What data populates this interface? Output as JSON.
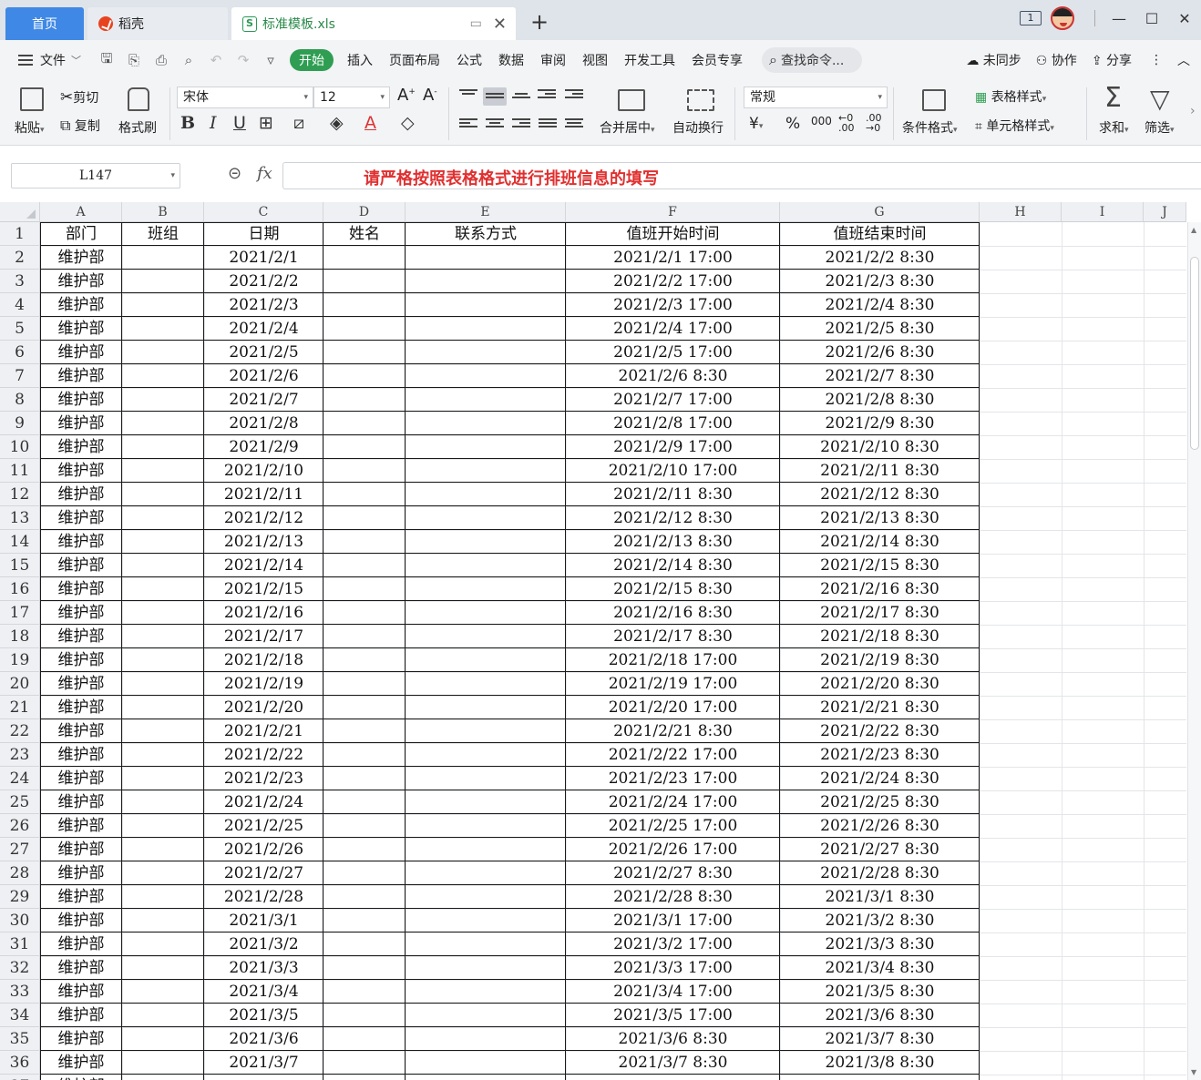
{
  "titlebar": {
    "tabs": [
      {
        "label": "首页"
      },
      {
        "label": "稻壳"
      },
      {
        "label": "标准模板.xls"
      }
    ],
    "new_tab_label": "+",
    "page_indicator": "1"
  },
  "menubar": {
    "file_label": "文件",
    "items": [
      "开始",
      "插入",
      "页面布局",
      "公式",
      "数据",
      "审阅",
      "视图",
      "开发工具",
      "会员专享"
    ],
    "search_placeholder": "查找命令...",
    "right_items": [
      "未同步",
      "协作",
      "分享"
    ]
  },
  "ribbon": {
    "paste_label": "粘贴",
    "cut_label": "剪切",
    "copy_label": "复制",
    "format_painter_label": "格式刷",
    "font_name": "宋体",
    "font_size": "12",
    "merge_label": "合并居中",
    "wrap_label": "自动换行",
    "number_format": "常规",
    "cond_format_label": "条件格式",
    "table_style_label": "表格样式",
    "cell_style_label": "单元格样式",
    "sum_label": "求和",
    "filter_label": "筛选"
  },
  "formula_bar": {
    "cell_ref": "L147",
    "fx_label": "fx",
    "content": "请严格按照表格格式进行排班信息的填写"
  },
  "sheet": {
    "columns": [
      "A",
      "B",
      "C",
      "D",
      "E",
      "F",
      "G",
      "H",
      "I",
      "J"
    ],
    "header_row": [
      "部门",
      "班组",
      "日期",
      "姓名",
      "联系方式",
      "值班开始时间",
      "值班结束时间"
    ],
    "rows": [
      {
        "n": "2",
        "dept": "维护部",
        "date": "2021/2/1",
        "start": "2021/2/1 17:00",
        "end": "2021/2/2 8:30"
      },
      {
        "n": "3",
        "dept": "维护部",
        "date": "2021/2/2",
        "start": "2021/2/2 17:00",
        "end": "2021/2/3 8:30"
      },
      {
        "n": "4",
        "dept": "维护部",
        "date": "2021/2/3",
        "start": "2021/2/3 17:00",
        "end": "2021/2/4 8:30"
      },
      {
        "n": "5",
        "dept": "维护部",
        "date": "2021/2/4",
        "start": "2021/2/4 17:00",
        "end": "2021/2/5 8:30"
      },
      {
        "n": "6",
        "dept": "维护部",
        "date": "2021/2/5",
        "start": "2021/2/5 17:00",
        "end": "2021/2/6 8:30"
      },
      {
        "n": "7",
        "dept": "维护部",
        "date": "2021/2/6",
        "start": "2021/2/6 8:30",
        "end": "2021/2/7 8:30"
      },
      {
        "n": "8",
        "dept": "维护部",
        "date": "2021/2/7",
        "start": "2021/2/7 17:00",
        "end": "2021/2/8 8:30"
      },
      {
        "n": "9",
        "dept": "维护部",
        "date": "2021/2/8",
        "start": "2021/2/8 17:00",
        "end": "2021/2/9 8:30"
      },
      {
        "n": "10",
        "dept": "维护部",
        "date": "2021/2/9",
        "start": "2021/2/9 17:00",
        "end": "2021/2/10 8:30"
      },
      {
        "n": "11",
        "dept": "维护部",
        "date": "2021/2/10",
        "start": "2021/2/10 17:00",
        "end": "2021/2/11 8:30"
      },
      {
        "n": "12",
        "dept": "维护部",
        "date": "2021/2/11",
        "start": "2021/2/11 8:30",
        "end": "2021/2/12 8:30"
      },
      {
        "n": "13",
        "dept": "维护部",
        "date": "2021/2/12",
        "start": "2021/2/12 8:30",
        "end": "2021/2/13 8:30"
      },
      {
        "n": "14",
        "dept": "维护部",
        "date": "2021/2/13",
        "start": "2021/2/13 8:30",
        "end": "2021/2/14 8:30"
      },
      {
        "n": "15",
        "dept": "维护部",
        "date": "2021/2/14",
        "start": "2021/2/14 8:30",
        "end": "2021/2/15 8:30"
      },
      {
        "n": "16",
        "dept": "维护部",
        "date": "2021/2/15",
        "start": "2021/2/15 8:30",
        "end": "2021/2/16 8:30"
      },
      {
        "n": "17",
        "dept": "维护部",
        "date": "2021/2/16",
        "start": "2021/2/16 8:30",
        "end": "2021/2/17 8:30"
      },
      {
        "n": "18",
        "dept": "维护部",
        "date": "2021/2/17",
        "start": "2021/2/17 8:30",
        "end": "2021/2/18 8:30"
      },
      {
        "n": "19",
        "dept": "维护部",
        "date": "2021/2/18",
        "start": "2021/2/18 17:00",
        "end": "2021/2/19 8:30"
      },
      {
        "n": "20",
        "dept": "维护部",
        "date": "2021/2/19",
        "start": "2021/2/19 17:00",
        "end": "2021/2/20 8:30"
      },
      {
        "n": "21",
        "dept": "维护部",
        "date": "2021/2/20",
        "start": "2021/2/20 17:00",
        "end": "2021/2/21 8:30"
      },
      {
        "n": "22",
        "dept": "维护部",
        "date": "2021/2/21",
        "start": "2021/2/21 8:30",
        "end": "2021/2/22 8:30"
      },
      {
        "n": "23",
        "dept": "维护部",
        "date": "2021/2/22",
        "start": "2021/2/22 17:00",
        "end": "2021/2/23 8:30"
      },
      {
        "n": "24",
        "dept": "维护部",
        "date": "2021/2/23",
        "start": "2021/2/23 17:00",
        "end": "2021/2/24 8:30"
      },
      {
        "n": "25",
        "dept": "维护部",
        "date": "2021/2/24",
        "start": "2021/2/24 17:00",
        "end": "2021/2/25 8:30"
      },
      {
        "n": "26",
        "dept": "维护部",
        "date": "2021/2/25",
        "start": "2021/2/25 17:00",
        "end": "2021/2/26 8:30"
      },
      {
        "n": "27",
        "dept": "维护部",
        "date": "2021/2/26",
        "start": "2021/2/26 17:00",
        "end": "2021/2/27 8:30"
      },
      {
        "n": "28",
        "dept": "维护部",
        "date": "2021/2/27",
        "start": "2021/2/27 8:30",
        "end": "2021/2/28 8:30"
      },
      {
        "n": "29",
        "dept": "维护部",
        "date": "2021/2/28",
        "start": "2021/2/28 8:30",
        "end": "2021/3/1 8:30"
      },
      {
        "n": "30",
        "dept": "维护部",
        "date": "2021/3/1",
        "start": "2021/3/1 17:00",
        "end": "2021/3/2 8:30"
      },
      {
        "n": "31",
        "dept": "维护部",
        "date": "2021/3/2",
        "start": "2021/3/2 17:00",
        "end": "2021/3/3 8:30"
      },
      {
        "n": "32",
        "dept": "维护部",
        "date": "2021/3/3",
        "start": "2021/3/3 17:00",
        "end": "2021/3/4 8:30"
      },
      {
        "n": "33",
        "dept": "维护部",
        "date": "2021/3/4",
        "start": "2021/3/4 17:00",
        "end": "2021/3/5 8:30"
      },
      {
        "n": "34",
        "dept": "维护部",
        "date": "2021/3/5",
        "start": "2021/3/5 17:00",
        "end": "2021/3/6 8:30"
      },
      {
        "n": "35",
        "dept": "维护部",
        "date": "2021/3/6",
        "start": "2021/3/6 8:30",
        "end": "2021/3/7 8:30"
      },
      {
        "n": "36",
        "dept": "维护部",
        "date": "2021/3/7",
        "start": "2021/3/7 8:30",
        "end": "2021/3/8 8:30"
      }
    ]
  },
  "colors": {
    "accent": "#2f9e52",
    "home_tab": "#3f88e6",
    "formula_text": "#e03030"
  }
}
